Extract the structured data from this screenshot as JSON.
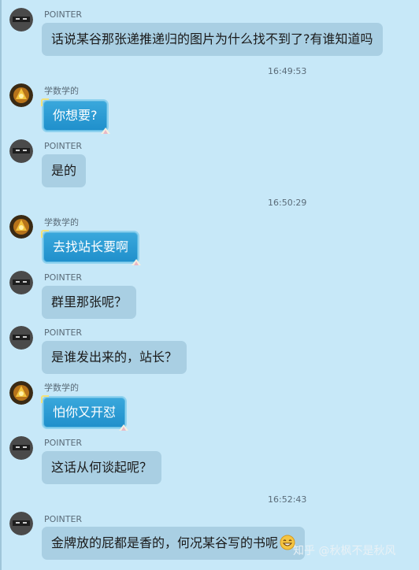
{
  "messages": [
    {
      "sender": "POINTER",
      "text": "话说某谷那张递推递归的图片为什么找不到了?有谁知道吗",
      "style": "gray"
    },
    {
      "sender": "学数学的",
      "text": "你想要?",
      "style": "blue"
    },
    {
      "sender": "POINTER",
      "text": "是的",
      "style": "gray"
    },
    {
      "sender": "学数学的",
      "text": "去找站长要啊",
      "style": "blue"
    },
    {
      "sender": "POINTER",
      "text": "群里那张呢？",
      "style": "gray"
    },
    {
      "sender": "POINTER",
      "text": "是谁发出来的，站长？",
      "style": "gray"
    },
    {
      "sender": "学数学的",
      "text": "怕你又开怼",
      "style": "blue"
    },
    {
      "sender": "POINTER",
      "text": "这话从何谈起呢？",
      "style": "gray"
    },
    {
      "sender": "POINTER",
      "text": "金牌放的屁都是香的，何况某谷写的书呢",
      "style": "gray",
      "emoji": "grin-emoji"
    }
  ],
  "timestamps": [
    "16:49:53",
    "16:50:29",
    "16:52:43"
  ],
  "watermark": "知乎 @秋枫不是秋风",
  "colors": {
    "background": "#c7e8f8",
    "gray_bubble": "#a9cfe3",
    "blue_bubble": "#2a9bd3"
  }
}
